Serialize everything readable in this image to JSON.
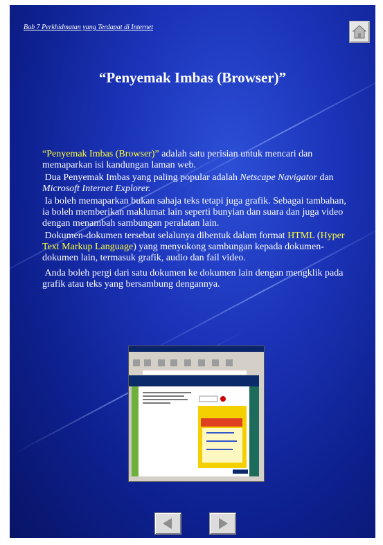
{
  "header": {
    "chapter_link": "Bab 7 Perkhidmatan yang Terdapat di Internet",
    "home_icon": "home-icon"
  },
  "slide": {
    "title": "“Penyemak Imbas (Browser)”"
  },
  "content": {
    "p1_highlight": "“Penyemak Imbas (Browser)”",
    "p1_rest": " adalah satu perisian untuk mencari dan memaparkan isi kandungan laman web.",
    "p2_start": "Dua Penyemak Imbas yang paling popular adalah ",
    "p2_netscape": "Netscape Navigator",
    "p2_and": " dan ",
    "p2_ie": "Microsoft Internet Explorer.",
    "p3": "Ia boleh memaparkan bukan sahaja teks tetapi juga grafik. Sebagai tambahan, ia boleh memberikan maklumat lain seperti bunyian dan suara dan juga video dengan menambah sambungan peralatan lain.",
    "p4_start": "Dokumen-dokumen tersebut selalunya dibentuk dalam format ",
    "p4_html": "HTML",
    "p4_open": " (",
    "p4_full": "Hyper Text Markup Language",
    "p4_rest": ") yang menyokong sambungan kepada dokumen-dokumen lain, termasuk grafik, audio dan fail video.",
    "p5": "Anda boleh pergi dari satu dokumen ke dokumen lain dengan mengklik pada grafik atau teks yang bersambung dengannya."
  },
  "screenshot": {
    "caption_icon": "browser-screenshot-image"
  },
  "navigation": {
    "prev_icon": "arrow-left-icon",
    "next_icon": "arrow-right-icon"
  },
  "colors": {
    "highlight": "#ffff33",
    "background": "#1b33b8"
  }
}
